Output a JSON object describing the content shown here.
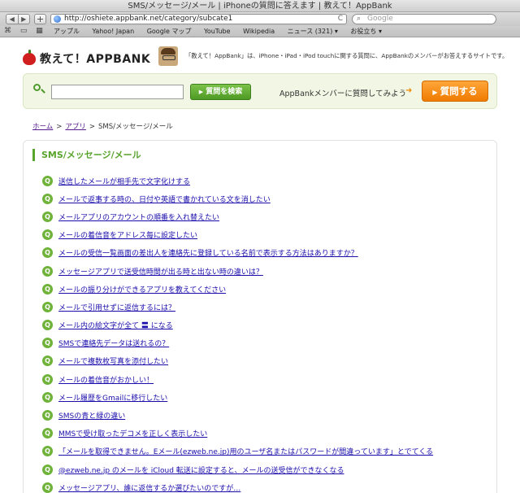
{
  "window": {
    "title": "SMS/メッセージ/メール | iPhoneの質問に答えます | 教えて！AppBank"
  },
  "toolbar": {
    "back": "◀",
    "forward": "▶",
    "add": "+",
    "url": "http://oshiete.appbank.net/category/subcate1",
    "reload": "C",
    "search_placeholder": "Google"
  },
  "bookmarks": {
    "icons": "⌘ ▭ ▦",
    "items": [
      "アップル",
      "Yahoo! Japan",
      "Google マップ",
      "YouTube",
      "Wikipedia",
      "ニュース (321) ▾",
      "お役立ち ▾"
    ]
  },
  "site": {
    "logo": "教えて！APPBANK",
    "tagline": "「教えて！AppBank」は、iPhone・iPad・iPod touchに関する質問に、AppBankのメンバーがお答えするサイトです。"
  },
  "search": {
    "input_value": "",
    "button_label": "質問を検索",
    "ask_prompt": "AppBankメンバーに質問してみよう",
    "ask_button_label": "質問する"
  },
  "breadcrumb": {
    "home": "ホーム",
    "sep1": ">",
    "apps": "アプリ",
    "sep2": ">",
    "current": "SMS/メッセージ/メール"
  },
  "section": {
    "title": "SMS/メッセージ/メール",
    "q_badge": "Q",
    "questions": [
      "送信したメールが相手先で文字化けする",
      "メールで返事する時の、日付や英語で書かれている文を消したい",
      "メールアプリのアカウントの順番を入れ替えたい",
      "メールの着信音をアドレス毎に設定したい",
      "メールの受信一覧画面の差出人を連絡先に登録している名前で表示する方法はありますか？",
      "メッセージアプリで送受信時間が出る時と出ない時の違いは？",
      "メールの振り分けができるアプリを教えてください",
      "メールで引用せずに返信するには？",
      "メール内の絵文字が全て 〓 になる",
      "SMSで連絡先データは送れるの？",
      "メールで複数枚写真を添付したい",
      "メールの着信音がおかしい！",
      "メール履歴をGmailに移行したい",
      "SMSの青と緑の違い",
      "MMSで受け取ったデコメを正しく表示したい",
      "「メールを取得できません。Eメール(ezweb.ne.jp)用のユーザ名またはパスワードが間違っています」とでてくる",
      "@ezweb.ne.jp のメールを iCloud 転送に設定すると、メールの送受信ができなくなる",
      "メッセージアプリ、誰に返信するか選びたいのですが…"
    ]
  }
}
